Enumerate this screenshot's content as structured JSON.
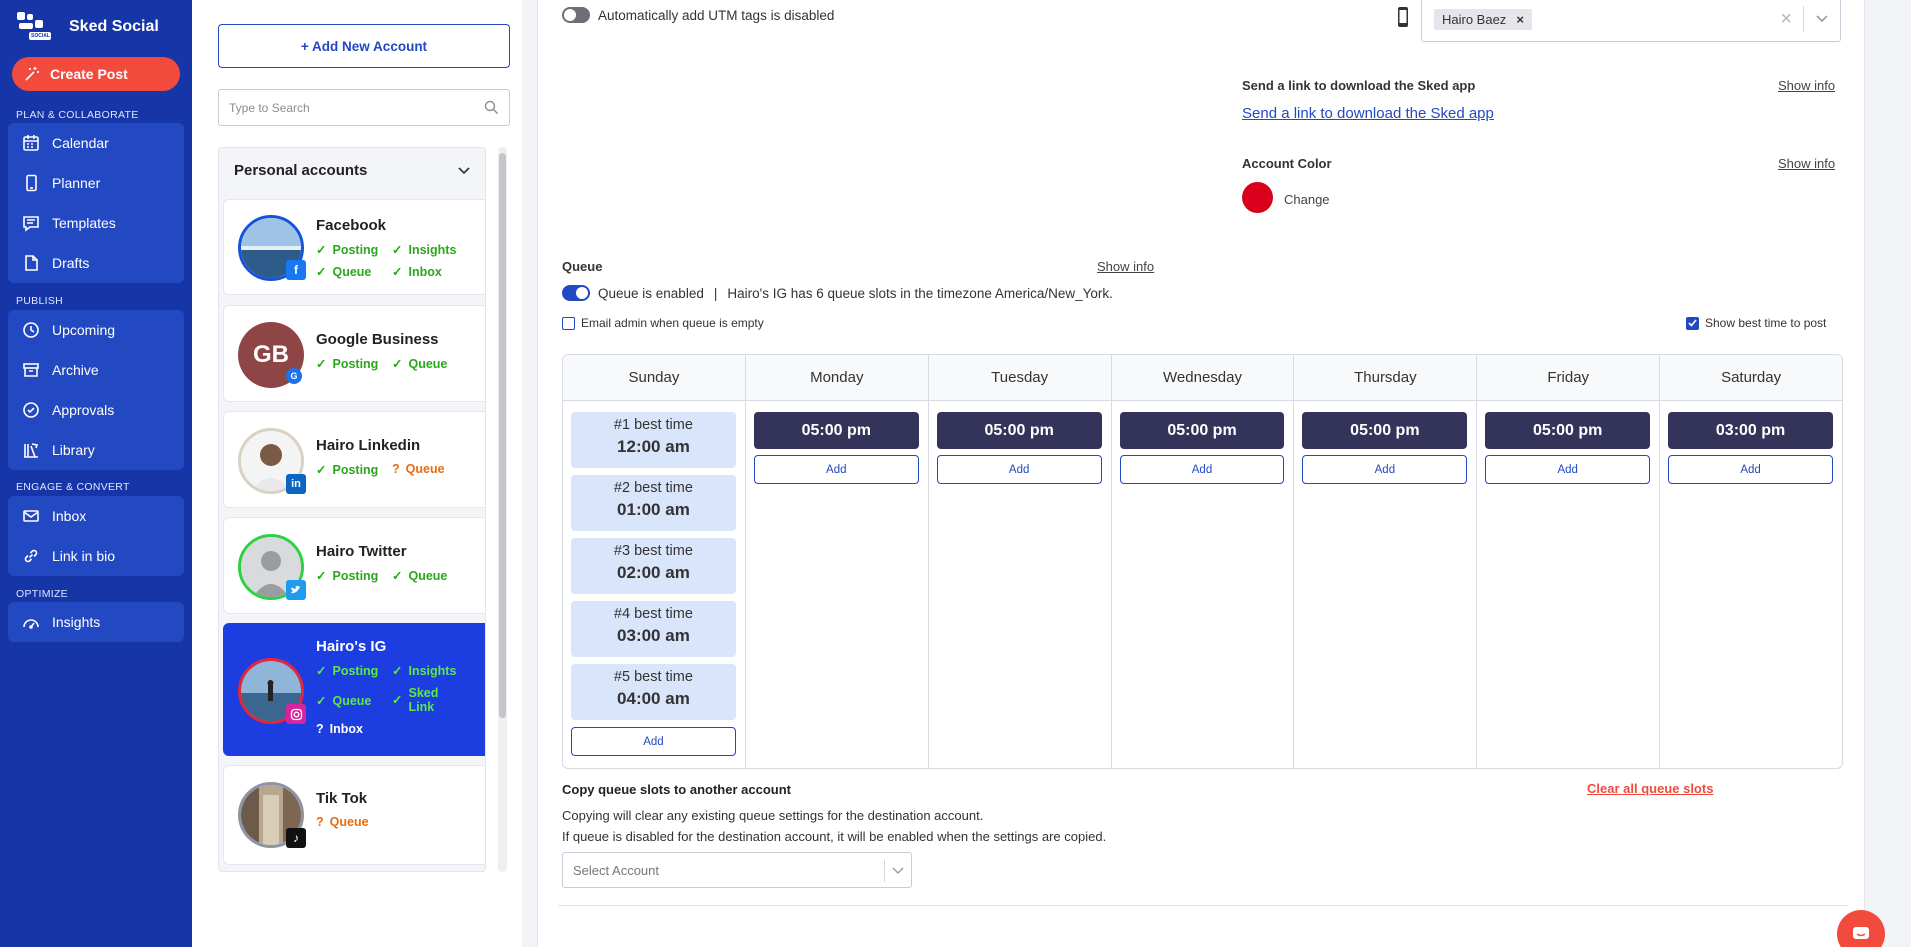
{
  "brand": {
    "name": "Sked Social",
    "logo_text": "SOCIAL"
  },
  "sidebar": {
    "create_post": "Create Post",
    "sections": {
      "plan": "PLAN & COLLABORATE",
      "publish": "PUBLISH",
      "engage": "ENGAGE & CONVERT",
      "optimize": "OPTIMIZE"
    },
    "items": {
      "calendar": "Calendar",
      "planner": "Planner",
      "templates": "Templates",
      "drafts": "Drafts",
      "upcoming": "Upcoming",
      "archive": "Archive",
      "approvals": "Approvals",
      "library": "Library",
      "inbox": "Inbox",
      "link_in_bio": "Link in bio",
      "insights": "Insights"
    }
  },
  "accounts": {
    "add_button": "+ Add New Account",
    "search_placeholder": "Type to Search",
    "group_title": "Personal accounts",
    "list": [
      {
        "name": "Facebook",
        "features": [
          "Posting",
          "Insights",
          "Queue",
          "Inbox"
        ]
      },
      {
        "name": "Google Business",
        "initials": "GB",
        "features": [
          "Posting",
          "Queue"
        ]
      },
      {
        "name": "Hairo Linkedin",
        "features": [
          "Posting",
          "Queue"
        ],
        "warn": [
          "Queue"
        ]
      },
      {
        "name": "Hairo Twitter",
        "features": [
          "Posting",
          "Queue"
        ]
      },
      {
        "name": "Hairo's IG",
        "features": [
          "Posting",
          "Insights",
          "Queue",
          "Sked Link",
          "Inbox"
        ],
        "warn": [
          "Inbox"
        ]
      },
      {
        "name": "Tik Tok",
        "features": [
          "Queue"
        ],
        "warn": [
          "Queue"
        ]
      }
    ]
  },
  "settings": {
    "utm": "Automatically add UTM tags is disabled",
    "user_tag": "Hairo Baez",
    "send_link_title": "Send a link to download the Sked app",
    "send_link": "Send a link to download the Sked app",
    "show_info": "Show info",
    "account_color_title": "Account Color",
    "account_color_value": "#d9001b",
    "change": "Change",
    "queue_title": "Queue",
    "queue_enabled": "Queue is enabled",
    "queue_sep": "|",
    "queue_desc": "Hairo's IG has 6 queue slots in the timezone America/New_York.",
    "email_admin": "Email admin when queue is empty",
    "show_best": "Show best time to post",
    "days": [
      "Sunday",
      "Monday",
      "Tuesday",
      "Wednesday",
      "Thursday",
      "Friday",
      "Saturday"
    ],
    "best_times": [
      {
        "label": "#1 best time",
        "time": "12:00 am"
      },
      {
        "label": "#2 best time",
        "time": "01:00 am"
      },
      {
        "label": "#3 best time",
        "time": "02:00 am"
      },
      {
        "label": "#4 best time",
        "time": "03:00 am"
      },
      {
        "label": "#5 best time",
        "time": "04:00 am"
      }
    ],
    "slots": {
      "monday": "05:00 pm",
      "tuesday": "05:00 pm",
      "wednesday": "05:00 pm",
      "thursday": "05:00 pm",
      "friday": "05:00 pm",
      "saturday": "03:00 pm"
    },
    "add_label": "Add",
    "copy_title": "Copy queue slots to another account",
    "clear_all": "Clear all queue slots",
    "copy_desc1": "Copying will clear any existing queue settings for the destination account.",
    "copy_desc2": "If queue is disabled for the destination account, it will be enabled when the settings are copied.",
    "select_account": "Select Account"
  },
  "colors": {
    "sidebar": "#1636a8",
    "sidebar_group": "#2349c2",
    "accent": "#2349c2",
    "create_post": "#f24b3e",
    "active_account": "#1c3de0",
    "slot": "#34345a",
    "best_time": "#d9e5fb",
    "ok": "#2aa81b",
    "warn": "#ea6a12"
  }
}
